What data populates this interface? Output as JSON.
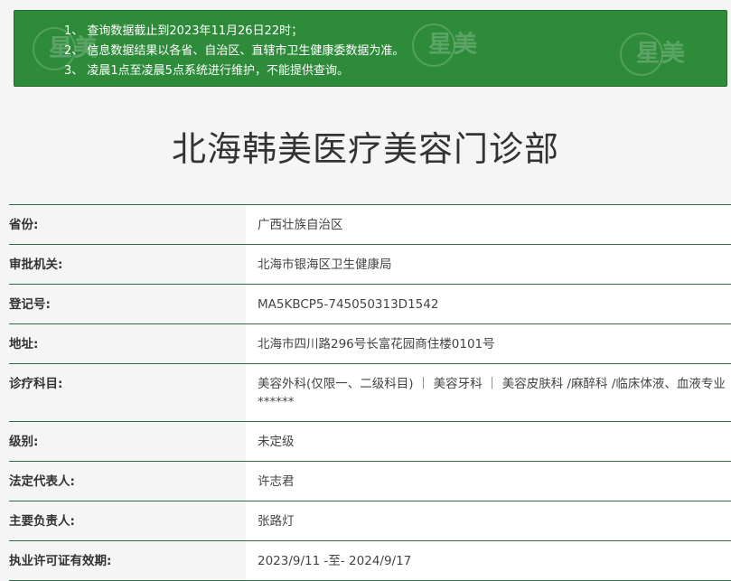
{
  "notice": {
    "lines": [
      "1、 查询数据截止到2023年11月26日22时；",
      "2、 信息数据结果以各省、自治区、直辖市卫生健康委数据为准。",
      "3、 凌晨1点至凌晨5点系统进行维护，不能提供查询。"
    ],
    "bg_color": "#2e8b3a"
  },
  "watermark": {
    "text": "星美"
  },
  "page_title": "北海韩美医疗美容门诊部",
  "rows": [
    {
      "label": "省份:",
      "value": "广西壮族自治区"
    },
    {
      "label": "审批机关:",
      "value": "北海市银海区卫生健康局"
    },
    {
      "label": "登记号:",
      "value": "MA5KBCP5-745050313D1542"
    },
    {
      "label": "地址:",
      "value": "北海市四川路296号长富花园商住楼0101号"
    },
    {
      "label": "诊疗科目:",
      "value": "美容外科(仅限一、二级科目) ｜ 美容牙科 ｜ 美容皮肤科 /麻醉科 /临床体液、血液专业******"
    },
    {
      "label": "级别:",
      "value": "未定级"
    },
    {
      "label": "法定代表人:",
      "value": "许志君"
    },
    {
      "label": "主要负责人:",
      "value": "张路灯"
    },
    {
      "label": "执业许可证有效期:",
      "value": "2023/9/11 -至- 2024/9/17"
    }
  ],
  "colors": {
    "border": "#2b6e45",
    "label_bg": "#f5f5f5",
    "value_bg": "#ffffff"
  }
}
